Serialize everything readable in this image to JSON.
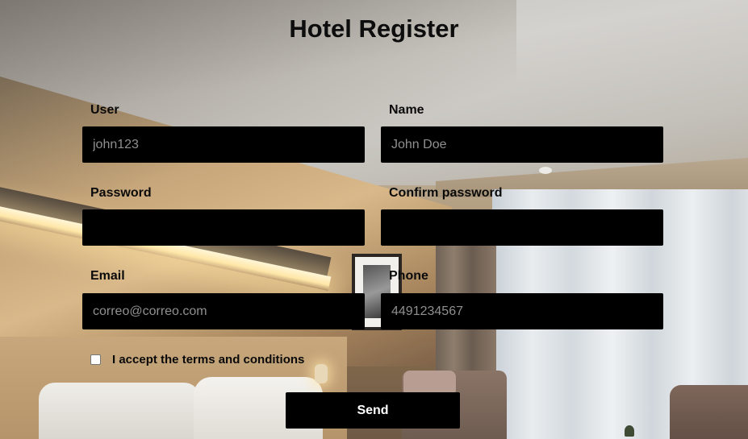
{
  "page": {
    "title": "Hotel Register"
  },
  "form": {
    "user": {
      "label": "User",
      "placeholder": "john123",
      "value": ""
    },
    "name": {
      "label": "Name",
      "placeholder": "John Doe",
      "value": ""
    },
    "password": {
      "label": "Password",
      "placeholder": "",
      "value": ""
    },
    "confirm_password": {
      "label": "Confirm password",
      "placeholder": "",
      "value": ""
    },
    "email": {
      "label": "Email",
      "placeholder": "correo@correo.com",
      "value": ""
    },
    "phone": {
      "label": "Phone",
      "placeholder": "4491234567",
      "value": ""
    },
    "terms": {
      "label": "I accept the terms and conditions",
      "checked": false
    },
    "submit_label": "Send"
  },
  "colors": {
    "input_background": "#000000",
    "button_background": "#000000",
    "button_text": "#ffffff",
    "label_text": "#0a0a0a"
  }
}
